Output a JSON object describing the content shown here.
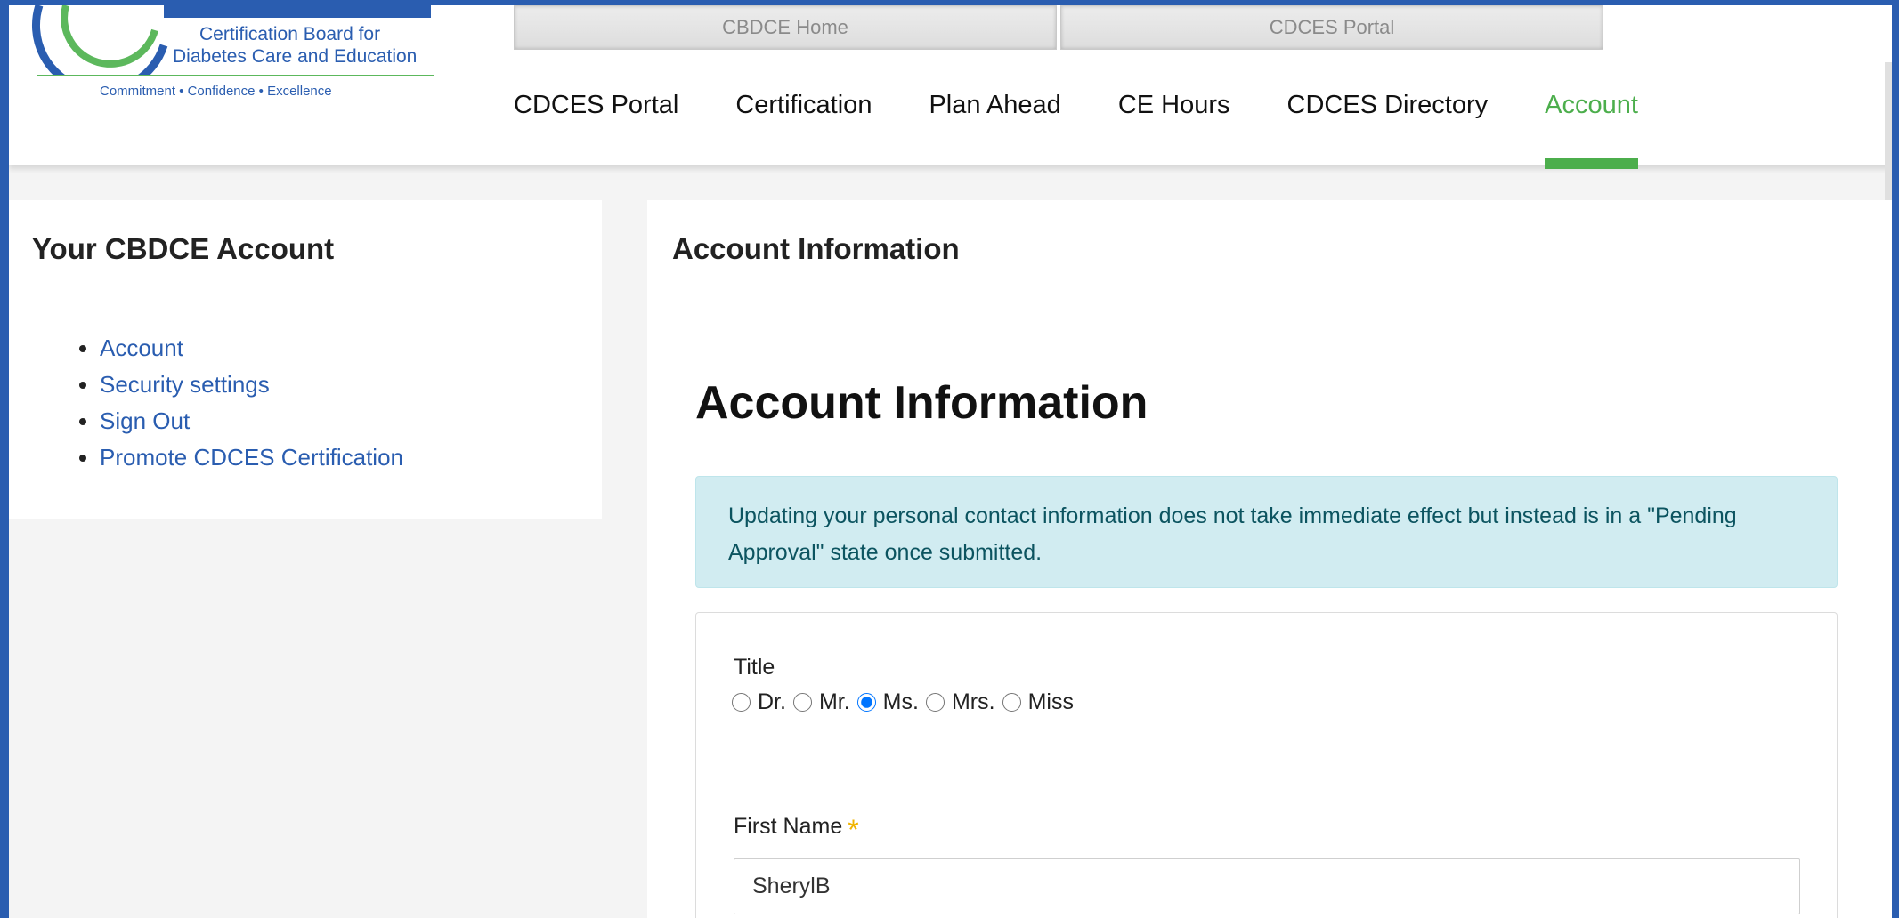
{
  "logo": {
    "line1": "Certification Board for",
    "line2": "Diabetes Care and Education",
    "tagline": "Commitment • Confidence • Excellence"
  },
  "top_tabs": [
    {
      "label": "CBDCE Home"
    },
    {
      "label": "CDCES Portal"
    }
  ],
  "nav": {
    "items": [
      {
        "label": "CDCES Portal"
      },
      {
        "label": "Certification"
      },
      {
        "label": "Plan Ahead"
      },
      {
        "label": "CE Hours"
      },
      {
        "label": "CDCES Directory"
      },
      {
        "label": "Account",
        "active": true
      }
    ]
  },
  "sidebar": {
    "title": "Your CBDCE Account",
    "links": [
      {
        "label": "Account"
      },
      {
        "label": "Security settings"
      },
      {
        "label": "Sign Out"
      },
      {
        "label": "Promote CDCES Certification"
      }
    ]
  },
  "main": {
    "heading": "Account Information",
    "page_heading": "Account Information",
    "alert": "Updating your personal contact information does not take immediate effect but instead is in a \"Pending Approval\" state once submitted.",
    "form": {
      "title_label": "Title",
      "title_options": [
        "Dr.",
        "Mr.",
        "Ms.",
        "Mrs.",
        "Miss"
      ],
      "title_selected": "Ms.",
      "first_name_label": "First Name",
      "required_mark": "*",
      "first_name_value": "SherylB"
    }
  },
  "colors": {
    "brand_blue": "#2a5db0",
    "accent_green": "#4cae4c",
    "alert_bg": "#d1ecf1",
    "required_star": "#f0b400"
  }
}
